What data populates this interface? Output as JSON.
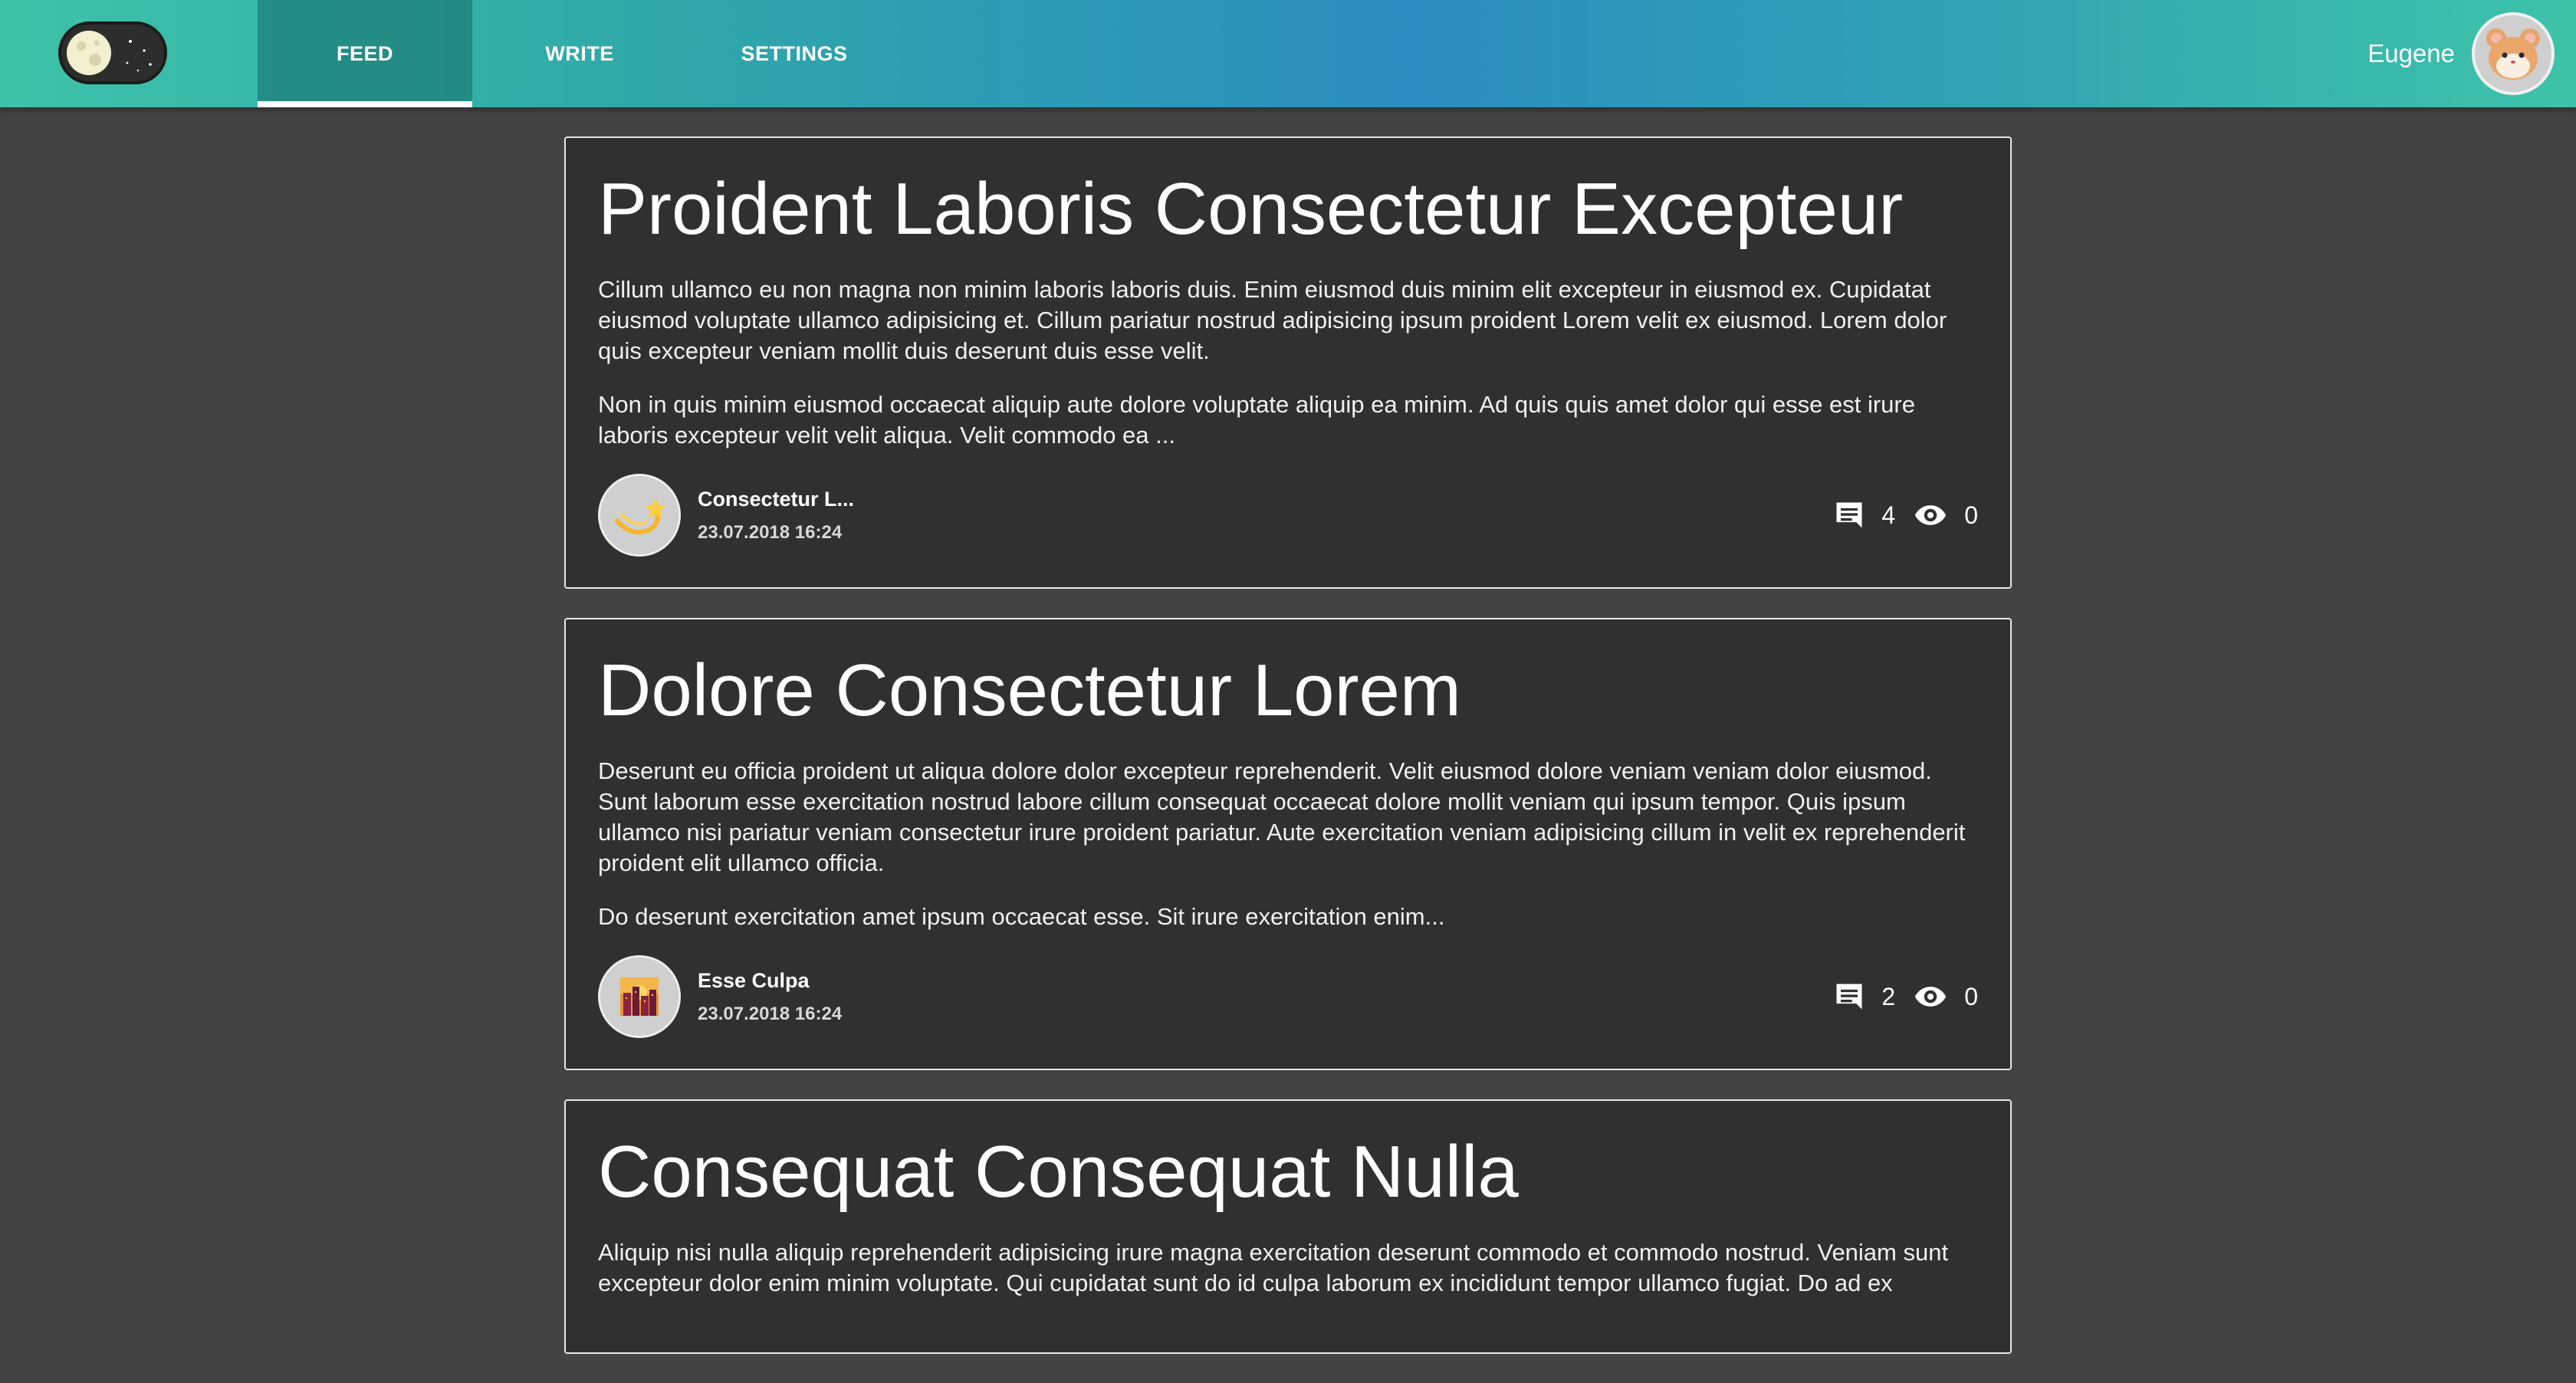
{
  "header": {
    "theme_toggle_icon": "moon-toggle-icon",
    "nav": [
      {
        "label": "FEED",
        "active": true
      },
      {
        "label": "WRITE",
        "active": false
      },
      {
        "label": "SETTINGS",
        "active": false
      }
    ],
    "user": {
      "name": "Eugene",
      "avatar_icon": "hamster-avatar-icon"
    }
  },
  "posts": [
    {
      "title": "Proident Laboris Consectetur Excepteur",
      "paragraphs": [
        "Cillum ullamco eu non magna non minim laboris laboris duis. Enim eiusmod duis minim elit excepteur in eiusmod ex. Cupidatat eiusmod voluptate ullamco adipisicing et. Cillum pariatur nostrud adipisicing ipsum proident Lorem velit ex eiusmod. Lorem dolor quis excepteur veniam mollit duis deserunt duis esse velit.",
        "Non in quis minim eiusmod occaecat aliquip aute dolore voluptate aliquip ea minim. Ad quis quis amet dolor qui esse est irure laboris excepteur velit velit aliqua. Velit commodo ea ..."
      ],
      "author": "Consectetur L...",
      "date": "23.07.2018 16:24",
      "comments": "4",
      "views": "0",
      "avatar_icon": "shooting-star-icon"
    },
    {
      "title": "Dolore Consectetur Lorem",
      "paragraphs": [
        "Deserunt eu officia proident ut aliqua dolore dolor excepteur reprehenderit. Velit eiusmod dolore veniam veniam dolor eiusmod. Sunt laborum esse exercitation nostrud labore cillum consequat occaecat dolore mollit veniam qui ipsum tempor. Quis ipsum ullamco nisi pariatur veniam consectetur irure proident pariatur. Aute exercitation veniam adipisicing cillum in velit ex reprehenderit proident elit ullamco officia.",
        "Do deserunt exercitation amet ipsum occaecat esse. Sit irure exercitation enim..."
      ],
      "author": "Esse Culpa",
      "date": "23.07.2018 16:24",
      "comments": "2",
      "views": "0",
      "avatar_icon": "city-sunset-icon"
    },
    {
      "title": "Consequat Consequat Nulla",
      "paragraphs": [
        "Aliquip nisi nulla aliquip reprehenderit adipisicing irure magna exercitation deserunt commodo et commodo nostrud. Veniam sunt excepteur dolor enim minim voluptate. Qui cupidatat sunt do id culpa laborum ex incididunt tempor ullamco fugiat. Do ad ex"
      ]
    }
  ],
  "colors": {
    "background": "#434343",
    "card": "#303030",
    "header_start": "#3ec3a8",
    "header_mid": "#2b8ec0"
  }
}
